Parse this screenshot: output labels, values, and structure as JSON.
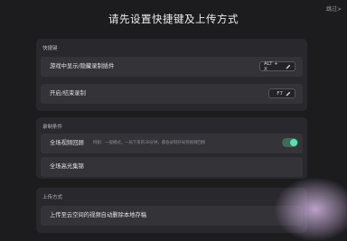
{
  "header": {
    "skip_label": "跳过>",
    "title": "请先设置快捷键及上传方式"
  },
  "shortcuts": {
    "section_title": "快捷键",
    "rows": [
      {
        "label": "游戏中显示/隐藏录制插件",
        "key": "ALT + X"
      },
      {
        "label": "开启/结束录制",
        "key": "F7"
      }
    ]
  },
  "recording": {
    "section_title": "录制条件",
    "rows": [
      {
        "label": "全场视频回顾",
        "hint": "例如：一般模式，一局下来的30分钟，都会录制开局到视频回顾",
        "toggle_on": true
      },
      {
        "label": "全场高光集锦"
      }
    ]
  },
  "upload": {
    "section_title": "上传方式",
    "rows": [
      {
        "label": "上传至云空间的视频自动删除本地存稿"
      }
    ]
  },
  "colors": {
    "toggle_accent": "#5de0b0",
    "background": "#1c1c1f"
  }
}
